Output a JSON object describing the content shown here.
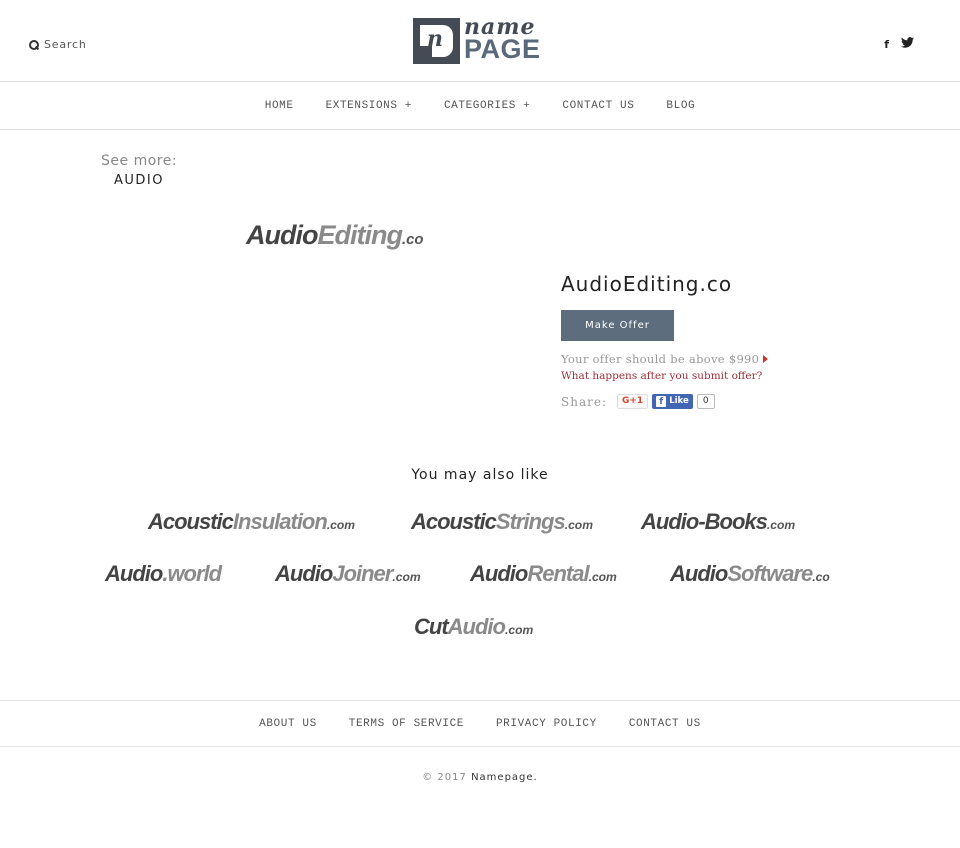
{
  "header": {
    "search_label": "Search",
    "logo": {
      "mark_letter": "n",
      "line1": "name",
      "line2": "PAGE"
    },
    "social": [
      {
        "name": "facebook",
        "glyph": "f"
      },
      {
        "name": "twitter",
        "glyph": "🐦"
      }
    ]
  },
  "nav": {
    "items": [
      "HOME",
      "EXTENSIONS +",
      "CATEGORIES +",
      "CONTACT US",
      "BLOG"
    ]
  },
  "see_more": {
    "label": "See more:",
    "category": "AUDIO"
  },
  "domain": {
    "logo": {
      "part_a": "Audio",
      "part_b": "Editing",
      "tld": ".co"
    },
    "title": "AudioEditing.co",
    "make_offer_label": "Make Offer",
    "offer_hint": "Your offer should be above $990",
    "min_offer": "$990",
    "what_happens_link": "What happens after you submit offer?",
    "share_label": "Share:",
    "gplus_label": "G+1",
    "fb_like_label": "Like",
    "fb_like_count": "0"
  },
  "related": {
    "heading": "You may also like",
    "items": [
      {
        "a": "Acoustic",
        "b": "Insulation",
        "tld": ".com"
      },
      {
        "a": "Acoustic",
        "b": "Strings",
        "tld": ".com"
      },
      {
        "a": "Audio-Books",
        "b": "",
        "tld": ".com"
      },
      {
        "a": "Audio",
        "b": ".world",
        "tld": ""
      },
      {
        "a": "Audio",
        "b": "Joiner",
        "tld": ".com"
      },
      {
        "a": "Audio",
        "b": "Rental",
        "tld": ".com"
      },
      {
        "a": "Audio",
        "b": "Software",
        "tld": ".co"
      },
      {
        "a": "Cut",
        "b": "Audio",
        "tld": ".com"
      }
    ]
  },
  "footer": {
    "links": [
      "ABOUT US",
      "TERMS OF SERVICE",
      "PRIVACY POLICY",
      "CONTACT US"
    ],
    "copyright_prefix": "© 2017",
    "copyright_brand": "Namepage."
  }
}
